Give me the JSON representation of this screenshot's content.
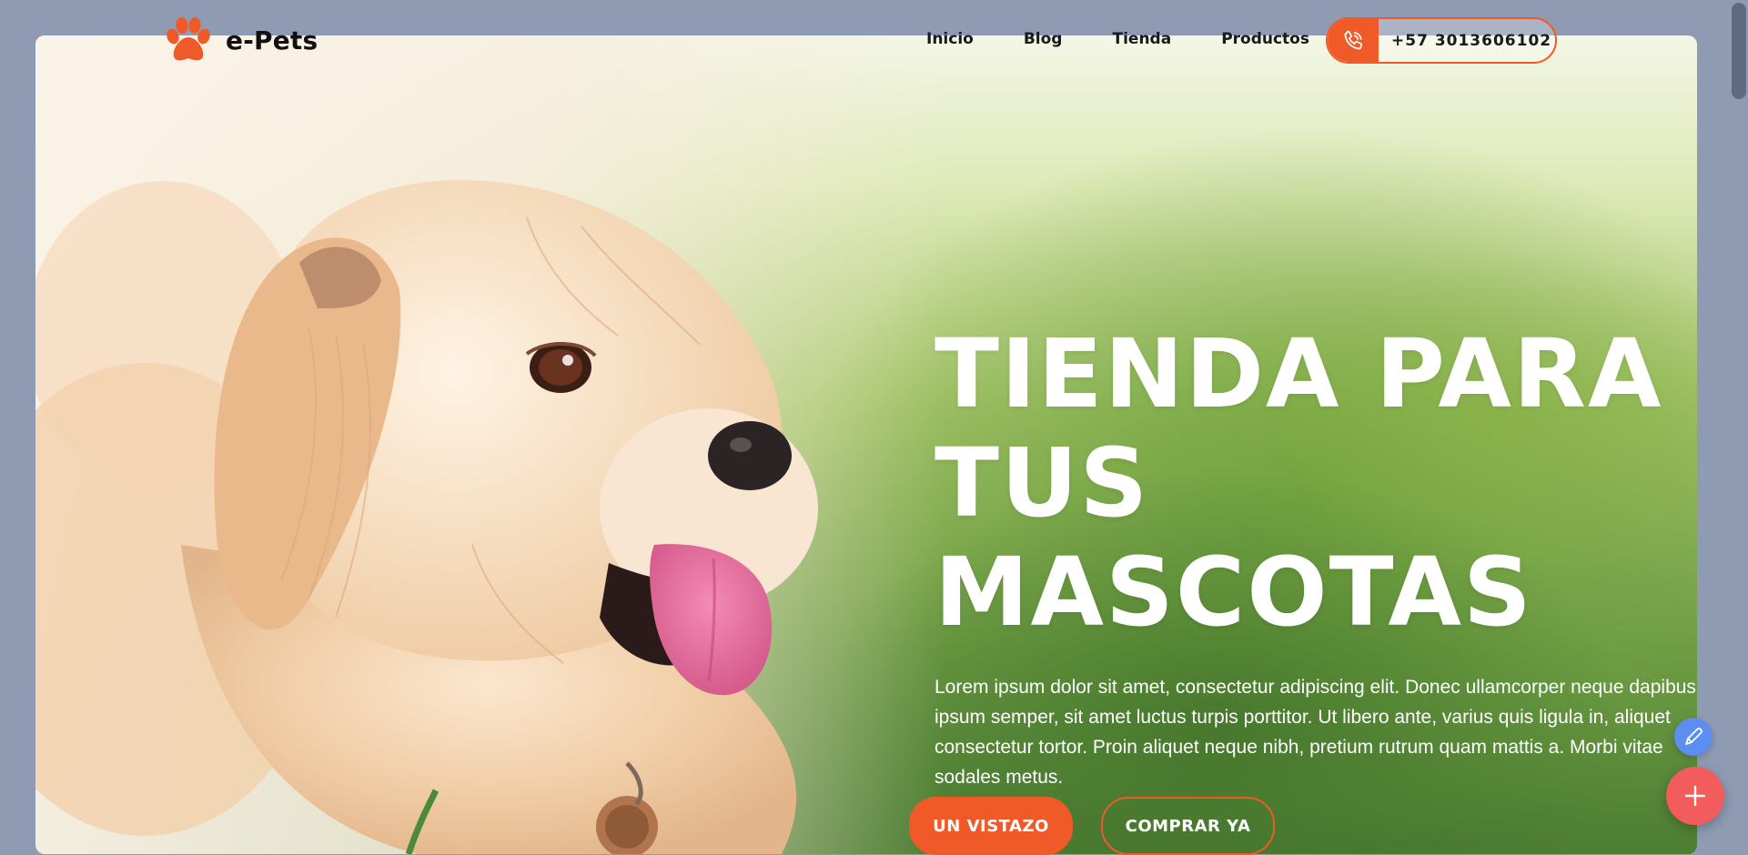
{
  "brand": {
    "name": "e-Pets",
    "logo_icon": "paw-icon",
    "accent_color": "#f05a28"
  },
  "nav": {
    "items": [
      {
        "label": "Inicio"
      },
      {
        "label": "Blog"
      },
      {
        "label": "Tienda"
      },
      {
        "label": "Productos"
      }
    ]
  },
  "contact": {
    "phone_icon": "phone-icon",
    "phone": "+57 3013606102"
  },
  "hero": {
    "title_lines": [
      "TIENDA PARA",
      "TUS",
      "MASCOTAS"
    ],
    "description": "Lorem ipsum dolor sit amet, consectetur adipiscing elit. Donec ullamcorper neque dapibus ipsum semper, sit amet luctus turpis porttitor. Ut libero ante, varius quis ligula in, aliquet consectetur tortor. Proin aliquet neque nibh, pretium rutrum quam mattis a. Morbi vitae sodales metus.",
    "primary_button": "UN VISTAZO",
    "secondary_button": "COMPRAR YA",
    "image": "dog-photo"
  },
  "widgets": {
    "edit_icon": "pencil-icon",
    "add_icon": "plus-icon",
    "edit_color": "#5b8ef0",
    "add_color": "#f25c5c"
  }
}
